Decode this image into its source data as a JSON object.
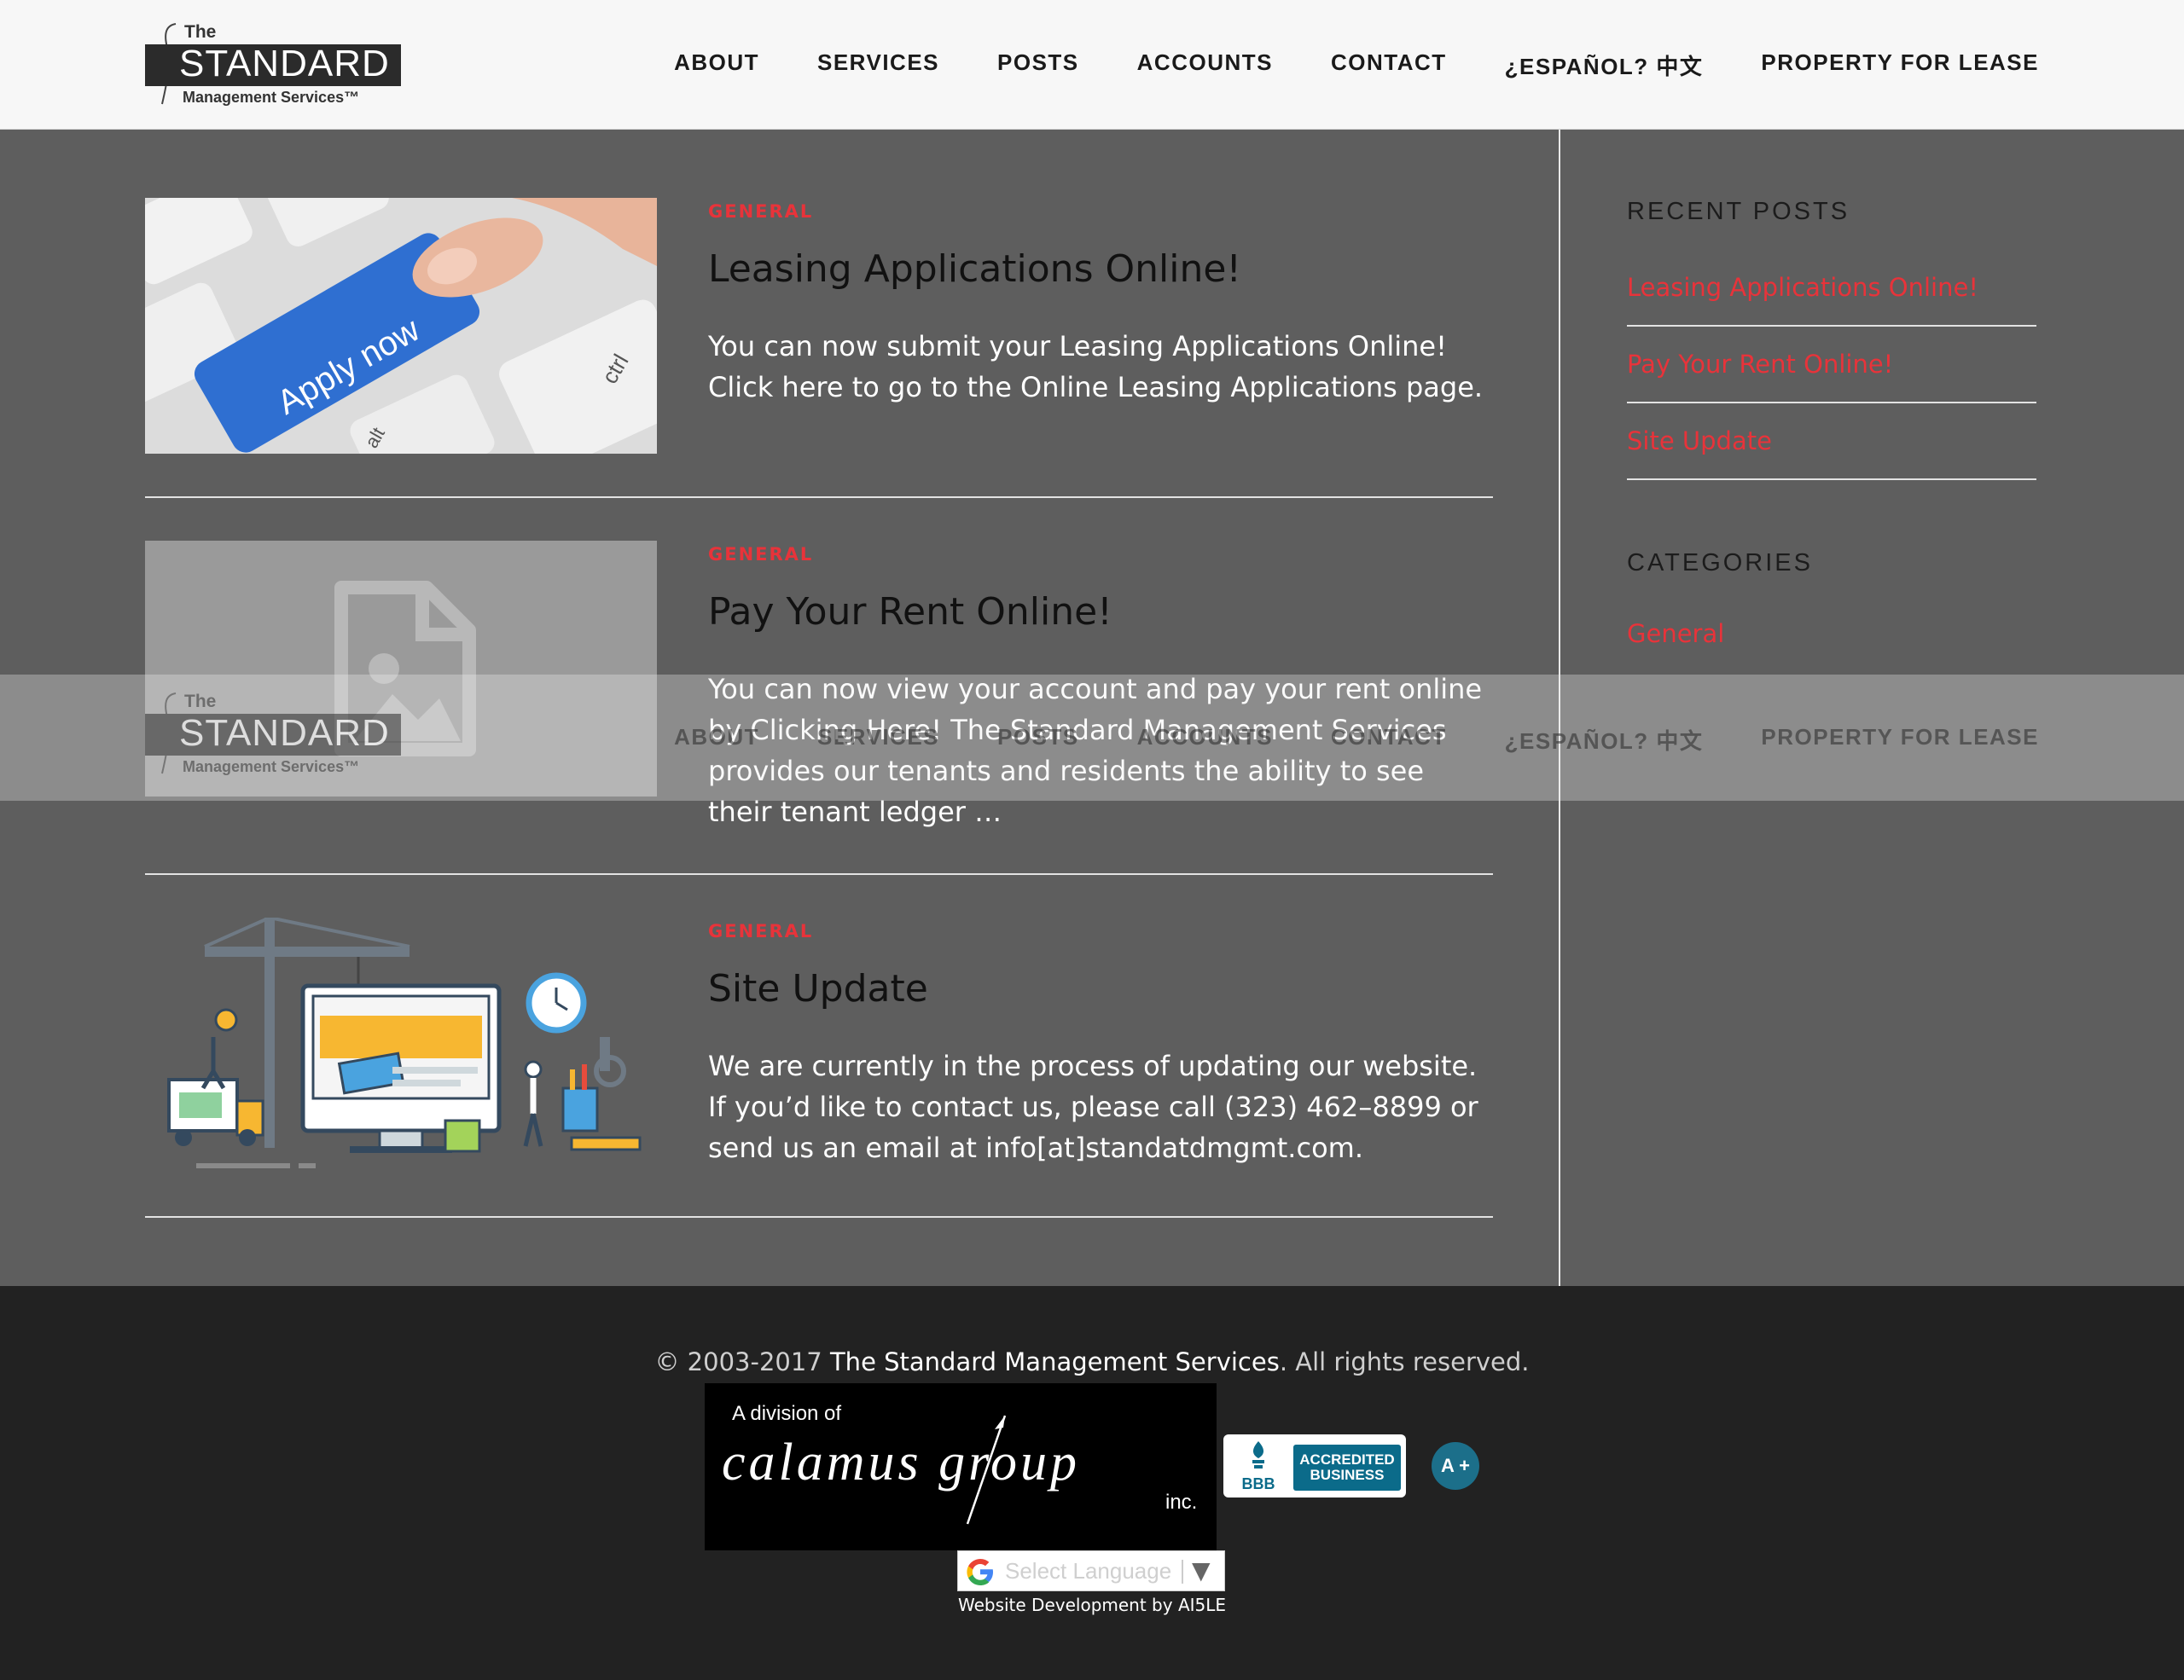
{
  "header": {
    "logo_the": "The",
    "logo_word": "STANDARD",
    "logo_sub": "Management Services™",
    "nav": [
      "ABOUT",
      "SERVICES",
      "POSTS",
      "ACCOUNTS",
      "CONTACT",
      "¿ESPAÑOL? 中文",
      "PROPERTY FOR LEASE"
    ]
  },
  "posts": [
    {
      "category": "GENERAL",
      "title": "Leasing Applications Online!",
      "excerpt": "You can now submit your Leasing Applications Online! Click here to go to the Online Leasing Applications page.",
      "image_label": "Apply now",
      "image_key": "ctrl",
      "image_key2": "alt"
    },
    {
      "category": "GENERAL",
      "title": "Pay Your Rent Online!",
      "excerpt": "You can now view your account and pay your rent online by Clicking Here! The Standard Management Services provides our tenants and residents the ability to see their tenant ledger …"
    },
    {
      "category": "GENERAL",
      "title": "Site Update",
      "excerpt": "We are currently in the process of updating our website. If you’d like to contact us, please call (323) 462–8899  or send us an email at info[at]standatdmgmt.com."
    }
  ],
  "sidebar": {
    "recent_heading": "RECENT POSTS",
    "recent": [
      "Leasing Applications Online!",
      "Pay Your Rent Online!",
      "Site Update"
    ],
    "categories_heading": "CATEGORIES",
    "categories": [
      "General"
    ]
  },
  "footer": {
    "copyright_prefix": "© 2003-2017 ",
    "company": "The Standard Management Services",
    "copyright_suffix": ". All rights reserved.",
    "calamus_division": "A division of",
    "calamus_name": "calamus  group",
    "calamus_inc": "inc.",
    "bbb_text": "BBB",
    "bbb_line1": "ACCREDITED",
    "bbb_line2": "BUSINESS",
    "bbb_rating": "A +",
    "language_placeholder": "Select Language",
    "dev_text": "Website Development by ",
    "dev_brand": "AI5LE"
  },
  "colors": {
    "accent_red": "#e8333a",
    "main_bg": "#5e5e5e",
    "footer_bg": "#222222",
    "bbb_blue": "#0b6b8a"
  }
}
